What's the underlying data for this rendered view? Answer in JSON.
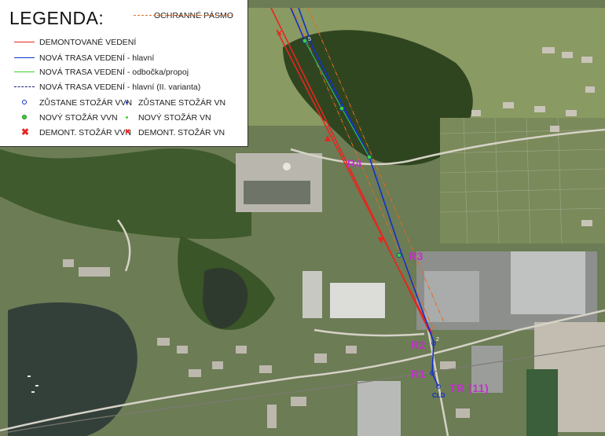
{
  "legend": {
    "title": "LEGENDA:",
    "extra": "OCHRANNÉ PÁSMO",
    "lines": [
      {
        "label": "DEMONTOVANÉ VEDENÍ",
        "color": "#e8261f",
        "style": "solid"
      },
      {
        "label": "NOVÁ TRASA VEDENÍ - hlavní",
        "color": "#1530c8",
        "style": "solid"
      },
      {
        "label": "NOVÁ TRASA VEDENÍ - odbočka/propoj",
        "color": "#3ad232",
        "style": "solid"
      },
      {
        "label": "NOVÁ TRASA VEDENÍ - hlavní (II. varianta)",
        "color": "#1b1f7a",
        "style": "dashed"
      }
    ],
    "col1": [
      {
        "label": "ZŮSTANE STOŽÁR VVN",
        "color": "#1530c8",
        "kind": "ring"
      },
      {
        "label": "NOVÝ STOŽÁR VVN",
        "color": "#3ad232",
        "kind": "dot"
      },
      {
        "label": "DEMONT. STOŽÁR VVN",
        "color": "#e8261f",
        "kind": "cross"
      }
    ],
    "col2": [
      {
        "label": "ZŮSTANE STOŽÁR VN",
        "color": "#1530c8",
        "kind": "small"
      },
      {
        "label": "NOVÝ STOŽÁR VN",
        "color": "#3ad232",
        "kind": "small"
      },
      {
        "label": "DEMONT. STOŽÁR VN",
        "color": "#e8261f",
        "kind": "smallcross"
      }
    ]
  },
  "labels": {
    "r4": "R4",
    "r3": "R3",
    "r2": "R2",
    "r1": "R1",
    "tr": "TR (11)",
    "cld": "CLD",
    "n5": "5",
    "n2": "2"
  },
  "colors": {
    "label": "#c032c8",
    "red": "#e8261f",
    "blue": "#1530c8",
    "green": "#3ad232"
  }
}
